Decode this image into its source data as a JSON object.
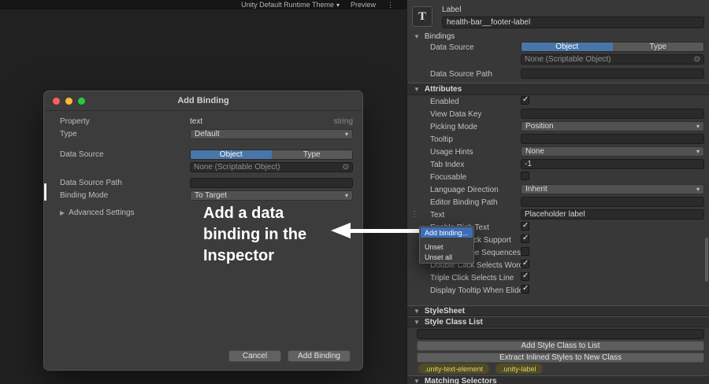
{
  "icons": {
    "foldout_open": "▼",
    "foldout_closed": "▶",
    "dropdown_arrow": "▾",
    "object_picker": "⊙",
    "kebab_menu": "⋮",
    "drag_handle": "⋮",
    "type_icon_glyph": "T"
  },
  "colors": {
    "selected_tab_blue": "#4976a8",
    "menu_highlight_blue": "#3d6db8",
    "traffic_close": "#ff5f57",
    "traffic_minimize": "#febc2e",
    "traffic_zoom": "#28c840",
    "class_pill_yellow": "#d8d372",
    "annotation": "#ffffff"
  },
  "viewport_toolbar": {
    "theme_selector": "Unity Default Runtime Theme",
    "preview": "Preview"
  },
  "annotation": {
    "lines": [
      "Add a data",
      "binding in the",
      "Inspector"
    ]
  },
  "add_binding_dialog": {
    "title": "Add Binding",
    "property": {
      "label": "Property",
      "value": "text",
      "type": "string"
    },
    "type_row": {
      "label": "Type",
      "value": "Default"
    },
    "data_source": {
      "label": "Data Source",
      "object_tab": "Object",
      "type_tab": "Type",
      "object_value": "None (Scriptable Object)"
    },
    "data_source_path": {
      "label": "Data Source Path",
      "value": ""
    },
    "binding_mode": {
      "label": "Binding Mode",
      "value": "To Target"
    },
    "advanced_settings": {
      "label": "Advanced Settings"
    },
    "footer": {
      "cancel": "Cancel",
      "add": "Add Binding"
    }
  },
  "inspector": {
    "element": {
      "type_name": "Label",
      "name": "health-bar__footer-label"
    },
    "bindings_section": {
      "title": "Bindings",
      "data_source": {
        "label": "Data Source",
        "object_tab": "Object",
        "type_tab": "Type",
        "object_value": "None (Scriptable Object)"
      },
      "data_source_path": {
        "label": "Data Source Path",
        "value": ""
      }
    },
    "attributes_section": {
      "title": "Attributes",
      "rows": [
        {
          "label": "Enabled",
          "control": "checkbox",
          "checked": true
        },
        {
          "label": "View Data Key",
          "control": "field",
          "value": ""
        },
        {
          "label": "Picking Mode",
          "control": "dropdown",
          "value": "Position"
        },
        {
          "label": "Tooltip",
          "control": "field",
          "value": ""
        },
        {
          "label": "Usage Hints",
          "control": "dropdown",
          "value": "None"
        },
        {
          "label": "Tab Index",
          "control": "field",
          "value": "-1"
        },
        {
          "label": "Focusable",
          "control": "checkbox",
          "checked": false
        },
        {
          "label": "Language Direction",
          "control": "dropdown",
          "value": "Inherit"
        },
        {
          "label": "Editor Binding Path",
          "control": "field",
          "value": ""
        },
        {
          "label": "Text",
          "control": "field",
          "value": "Placeholder label"
        },
        {
          "label": "Enable Rich Text",
          "control": "checkbox",
          "checked": true
        },
        {
          "label": "Emoji Fallback Support",
          "control": "checkbox",
          "checked": true
        },
        {
          "label": "Parse Escape Sequences",
          "control": "checkbox",
          "checked": false
        },
        {
          "label": "Double Click Selects Word",
          "control": "checkbox",
          "checked": true
        },
        {
          "label": "Triple Click Selects Line",
          "control": "checkbox",
          "checked": true
        },
        {
          "label": "Display Tooltip When Elided",
          "control": "checkbox",
          "checked": true
        }
      ]
    },
    "stylesheet_section": {
      "title": "StyleSheet"
    },
    "style_class_section": {
      "title": "Style Class List",
      "input_value": "",
      "add_button": "Add Style Class to List",
      "extract_button": "Extract Inlined Styles to New Class",
      "class_pills": [
        ".unity-text-element",
        ".unity-label"
      ]
    },
    "matching_selectors_section": {
      "title": "Matching Selectors"
    }
  },
  "context_menu": {
    "items": [
      {
        "label": "Add binding...",
        "highlighted": true
      },
      {
        "label": "Unset",
        "highlighted": false
      },
      {
        "label": "Unset all",
        "highlighted": false
      }
    ]
  }
}
